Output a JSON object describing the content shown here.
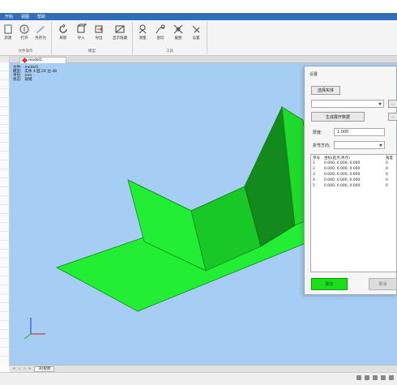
{
  "menu": {
    "items": [
      "开始",
      "视图",
      "帮助"
    ]
  },
  "ribbon": {
    "groups": [
      {
        "label": "文件操作",
        "buttons": [
          "新建",
          "打开",
          "另存为"
        ]
      },
      {
        "label": "模型",
        "buttons": [
          "刷新",
          "导入",
          "导出",
          "显示隐藏"
        ]
      },
      {
        "label": "工具",
        "buttons": [
          "测量",
          "剖切",
          "截图",
          "设置"
        ]
      }
    ]
  },
  "document_tab": {
    "label": "model1"
  },
  "viewport_info": {
    "lines": [
      {
        "key": "文件:",
        "value": "model1"
      },
      {
        "key": "模型:",
        "value": "实体 4  面 24  边 48"
      },
      {
        "key": "单位:",
        "value": "mm"
      },
      {
        "key": "状态:",
        "value": "就绪"
      }
    ]
  },
  "bottom_tabs": {
    "tab_label": "3D视图"
  },
  "dialog": {
    "title": "设置",
    "select_button": "选择实体",
    "compute_button": "生成展开数据",
    "field_label": "厚度:",
    "field_value": "1.000",
    "combo2_label": "折弯方向:",
    "side_button_1": "...",
    "side_button_2": "...",
    "list": {
      "headers": [
        "序号",
        "坐标(起点,终点)",
        "角度"
      ],
      "rows": [
        [
          "1",
          "0.000, 0.000, 0.000",
          "0"
        ],
        [
          "2",
          "0.000, 0.000, 0.000",
          "0"
        ],
        [
          "3",
          "0.000, 0.000, 0.000",
          "0"
        ],
        [
          "4",
          "0.000, 0.000, 0.000",
          "0"
        ],
        [
          "5",
          "0.000, 0.000, 0.000",
          "0"
        ]
      ]
    },
    "confirm_label": "确定",
    "cancel_label": "取消"
  },
  "colors": {
    "viewport_bg": "#a6cdf3",
    "model_light": "#22ee33",
    "model_mid": "#18c826",
    "model_dark": "#128a1c",
    "confirm_green": "#19e019"
  },
  "icons": [
    "new-icon",
    "open-icon",
    "save-as-icon",
    "refresh-icon",
    "import-icon",
    "export-icon",
    "visibility-icon",
    "measure-icon",
    "section-icon",
    "screenshot-icon",
    "settings-icon",
    "axis-triad-icon"
  ]
}
